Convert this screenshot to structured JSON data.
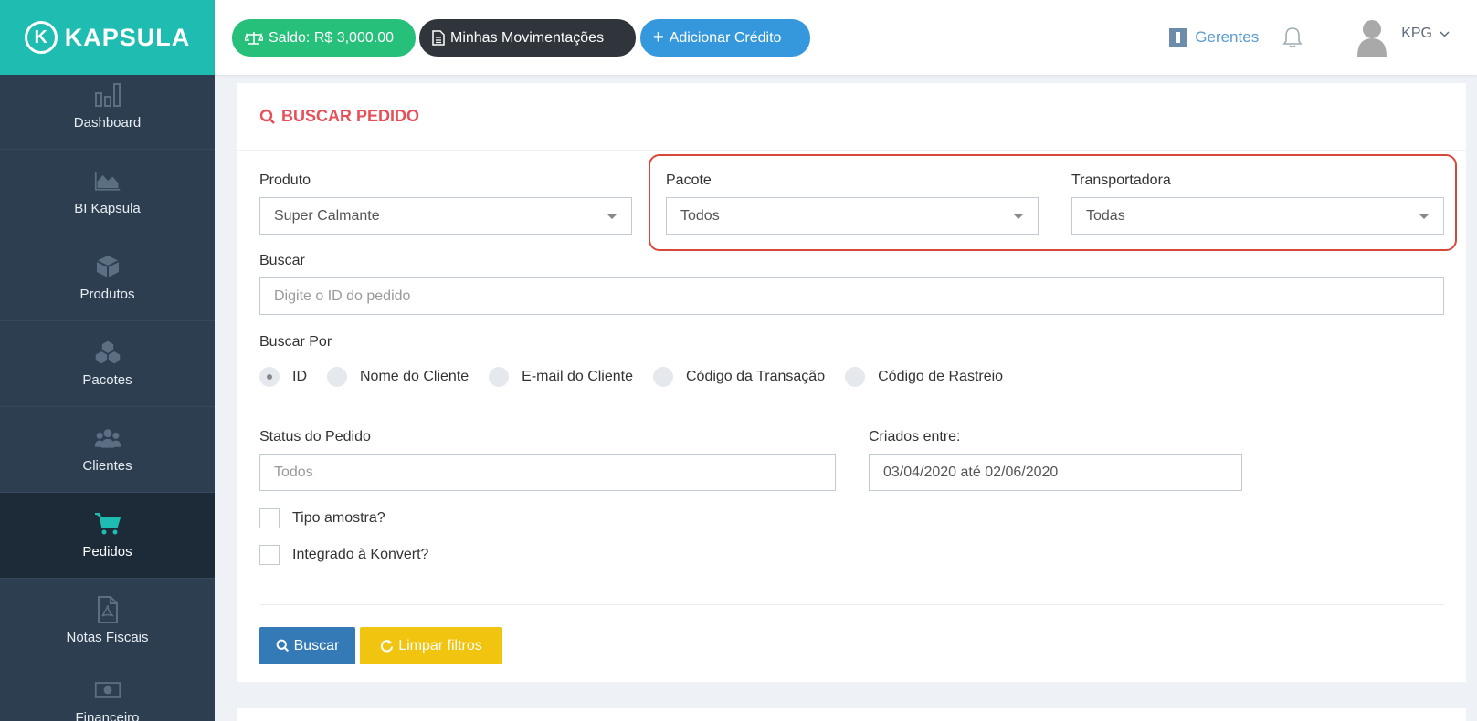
{
  "brand": {
    "name": "KAPSULA",
    "accent": "#1fbcb1"
  },
  "sidebar": {
    "items": [
      {
        "label": "Dashboard",
        "icon": "bar-chart-icon"
      },
      {
        "label": "BI Kapsula",
        "icon": "area-chart-icon"
      },
      {
        "label": "Produtos",
        "icon": "cube-icon"
      },
      {
        "label": "Pacotes",
        "icon": "cubes-icon"
      },
      {
        "label": "Clientes",
        "icon": "users-icon"
      },
      {
        "label": "Pedidos",
        "icon": "cart-icon",
        "active": true
      },
      {
        "label": "Notas Fiscais",
        "icon": "pdf-file-icon"
      },
      {
        "label": "Financeiro",
        "icon": "money-icon"
      }
    ]
  },
  "topbar": {
    "saldo": "Saldo: R$ 3,000.00",
    "movimentacoes": "Minhas Movimentações",
    "adicionar_credito": "Adicionar Crédito",
    "gerentes": "Gerentes",
    "user": "KPG"
  },
  "search": {
    "title": "BUSCAR PEDIDO",
    "produto": {
      "label": "Produto",
      "value": "Super Calmante"
    },
    "pacote": {
      "label": "Pacote",
      "value": "Todos"
    },
    "transportadora": {
      "label": "Transportadora",
      "value": "Todas"
    },
    "buscar": {
      "label": "Buscar",
      "placeholder": "Digite o ID do pedido"
    },
    "buscar_por": {
      "label": "Buscar Por",
      "options": [
        "ID",
        "Nome do Cliente",
        "E-mail do Cliente",
        "Código da Transação",
        "Código de Rastreio"
      ],
      "selected": "ID"
    },
    "status": {
      "label": "Status do Pedido",
      "placeholder": "Todos"
    },
    "criados": {
      "label": "Criados entre:",
      "value": "03/04/2020 até 02/06/2020"
    },
    "tipo_amostra": "Tipo amostra?",
    "integrado": "Integrado à Konvert?",
    "btn_buscar": "Buscar",
    "btn_limpar": "Limpar filtros"
  }
}
